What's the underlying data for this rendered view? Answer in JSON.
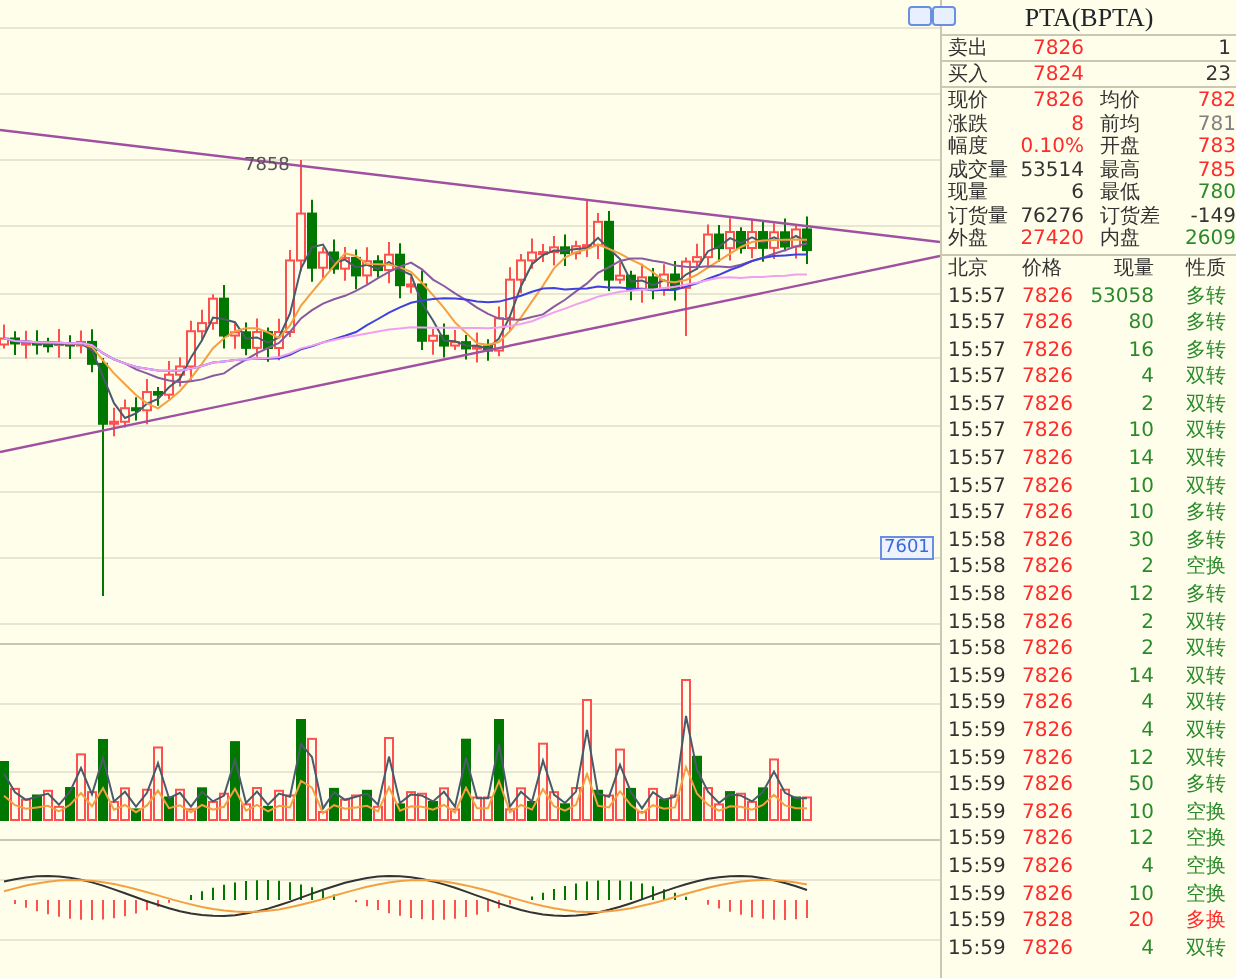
{
  "chart": {
    "high_label": "7858",
    "low_label": "7601"
  },
  "panel": {
    "title": "PTA(BPTA)",
    "orders": [
      {
        "label": "卖出",
        "price": "7826",
        "volume": "1"
      },
      {
        "label": "买入",
        "price": "7824",
        "volume": "23"
      }
    ],
    "quotes": [
      [
        {
          "label": "现价",
          "value": "7826",
          "color": "#ff2a2a"
        },
        {
          "label": "均价",
          "value": "782",
          "color": "#ff2a2a"
        }
      ],
      [
        {
          "label": "涨跌",
          "value": "8",
          "color": "#ff2a2a"
        },
        {
          "label": "前均",
          "value": "781",
          "color": "#808080"
        }
      ],
      [
        {
          "label": "幅度",
          "value": "0.10%",
          "color": "#ff2a2a"
        },
        {
          "label": "开盘",
          "value": "783",
          "color": "#ff2a2a"
        }
      ],
      [
        {
          "label": "成交量",
          "value": "53514",
          "color": "#333333"
        },
        {
          "label": "最高",
          "value": "785",
          "color": "#ff2a2a"
        }
      ],
      [
        {
          "label": "现量",
          "value": "6",
          "color": "#333333"
        },
        {
          "label": "最低",
          "value": "780",
          "color": "#2a8a2a"
        }
      ],
      [
        {
          "label": "订货量",
          "value": "76276",
          "color": "#333333"
        },
        {
          "label": "订货差",
          "value": "-149",
          "color": "#333333"
        }
      ],
      [
        {
          "label": "外盘",
          "value": "27420",
          "color": "#ff2a2a"
        },
        {
          "label": "内盘",
          "value": "2609",
          "color": "#2a8a2a"
        }
      ]
    ],
    "trade_columns": [
      "北京",
      "价格",
      "现量",
      "性质"
    ],
    "trades": [
      {
        "time": "15:57",
        "price": "7826",
        "volume": "53058",
        "nature": "多转",
        "color": "#2a8a2a"
      },
      {
        "time": "15:57",
        "price": "7826",
        "volume": "80",
        "nature": "多转",
        "color": "#2a8a2a"
      },
      {
        "time": "15:57",
        "price": "7826",
        "volume": "16",
        "nature": "多转",
        "color": "#2a8a2a"
      },
      {
        "time": "15:57",
        "price": "7826",
        "volume": "4",
        "nature": "双转",
        "color": "#2a8a2a"
      },
      {
        "time": "15:57",
        "price": "7826",
        "volume": "2",
        "nature": "双转",
        "color": "#2a8a2a"
      },
      {
        "time": "15:57",
        "price": "7826",
        "volume": "10",
        "nature": "双转",
        "color": "#2a8a2a"
      },
      {
        "time": "15:57",
        "price": "7826",
        "volume": "14",
        "nature": "双转",
        "color": "#2a8a2a"
      },
      {
        "time": "15:57",
        "price": "7826",
        "volume": "10",
        "nature": "双转",
        "color": "#2a8a2a"
      },
      {
        "time": "15:57",
        "price": "7826",
        "volume": "10",
        "nature": "多转",
        "color": "#2a8a2a"
      },
      {
        "time": "15:58",
        "price": "7826",
        "volume": "30",
        "nature": "多转",
        "color": "#2a8a2a"
      },
      {
        "time": "15:58",
        "price": "7826",
        "volume": "2",
        "nature": "空换",
        "color": "#2a8a2a"
      },
      {
        "time": "15:58",
        "price": "7826",
        "volume": "12",
        "nature": "多转",
        "color": "#2a8a2a"
      },
      {
        "time": "15:58",
        "price": "7826",
        "volume": "2",
        "nature": "双转",
        "color": "#2a8a2a"
      },
      {
        "time": "15:58",
        "price": "7826",
        "volume": "2",
        "nature": "双转",
        "color": "#2a8a2a"
      },
      {
        "time": "15:59",
        "price": "7826",
        "volume": "14",
        "nature": "双转",
        "color": "#2a8a2a"
      },
      {
        "time": "15:59",
        "price": "7826",
        "volume": "4",
        "nature": "双转",
        "color": "#2a8a2a"
      },
      {
        "time": "15:59",
        "price": "7826",
        "volume": "4",
        "nature": "双转",
        "color": "#2a8a2a"
      },
      {
        "time": "15:59",
        "price": "7826",
        "volume": "12",
        "nature": "双转",
        "color": "#2a8a2a"
      },
      {
        "time": "15:59",
        "price": "7826",
        "volume": "50",
        "nature": "多转",
        "color": "#2a8a2a"
      },
      {
        "time": "15:59",
        "price": "7826",
        "volume": "10",
        "nature": "空换",
        "color": "#2a8a2a"
      },
      {
        "time": "15:59",
        "price": "7826",
        "volume": "12",
        "nature": "空换",
        "color": "#2a8a2a"
      },
      {
        "time": "15:59",
        "price": "7826",
        "volume": "4",
        "nature": "空换",
        "color": "#2a8a2a"
      },
      {
        "time": "15:59",
        "price": "7826",
        "volume": "10",
        "nature": "空换",
        "color": "#2a8a2a"
      },
      {
        "time": "15:59",
        "price": "7828",
        "volume": "20",
        "nature": "多换",
        "color": "#ff2a2a"
      },
      {
        "time": "15:59",
        "price": "7826",
        "volume": "4",
        "nature": "双转",
        "color": "#2a8a2a"
      }
    ]
  }
}
